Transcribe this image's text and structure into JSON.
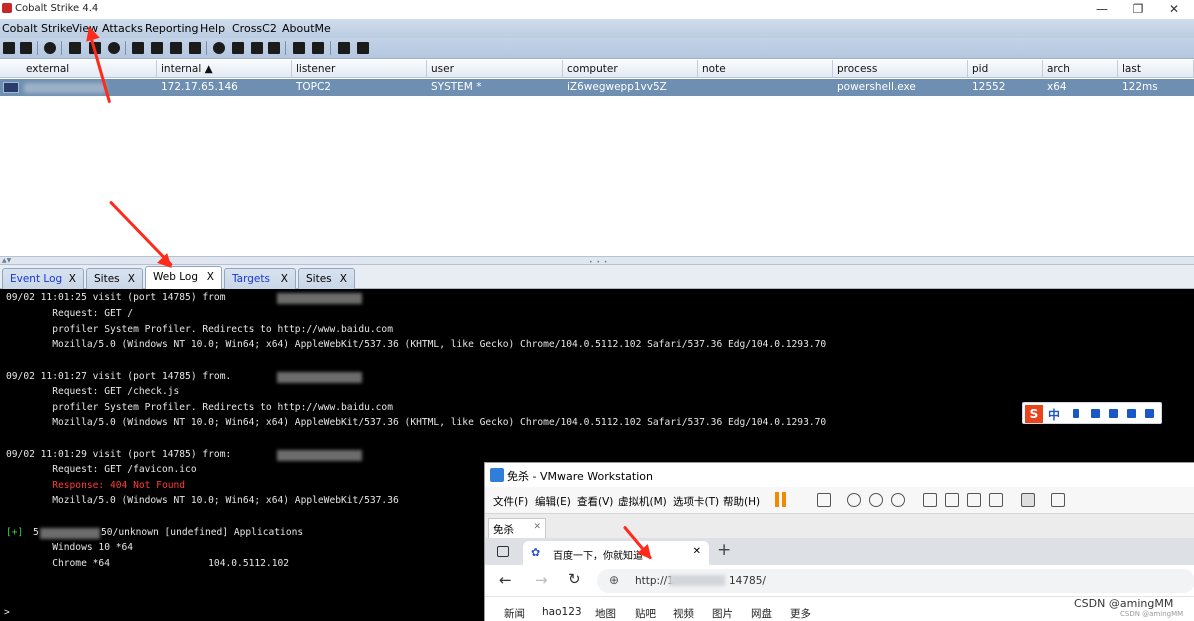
{
  "window": {
    "title": "Cobalt Strike 4.4"
  },
  "menu": [
    "Cobalt Strike",
    "View",
    "Attacks",
    "Reporting",
    "Help",
    "CrossC2",
    "AboutMe"
  ],
  "beacons": {
    "columns": [
      "external",
      "internal ▲",
      "listener",
      "user",
      "computer",
      "note",
      "process",
      "pid",
      "arch",
      "last"
    ],
    "row": {
      "external": "",
      "internal": "172.17.65.146",
      "listener": "TOPC2",
      "user": "SYSTEM *",
      "computer": "iZ6wegwepp1vv5Z",
      "note": "",
      "process": "powershell.exe",
      "pid": "12552",
      "arch": "x64",
      "last": "122ms"
    }
  },
  "tabs": [
    {
      "label": "Event Log",
      "close": "X"
    },
    {
      "label": "Sites",
      "close": "X"
    },
    {
      "label": "Web Log",
      "close": "X"
    },
    {
      "label": "Targets",
      "close": "X"
    },
    {
      "label": "Sites",
      "close": "X"
    }
  ],
  "console": {
    "lines": [
      "09/02 11:01:25 visit (port 14785) from",
      "        Request: GET /",
      "        profiler System Profiler. Redirects to http://www.baidu.com",
      "        Mozilla/5.0 (Windows NT 10.0; Win64; x64) AppleWebKit/537.36 (KHTML, like Gecko) Chrome/104.0.5112.102 Safari/537.36 Edg/104.0.1293.70",
      "09/02 11:01:27 visit (port 14785) from.",
      "        Request: GET /check.js",
      "        profiler System Profiler. Redirects to http://www.baidu.com",
      "        Mozilla/5.0 (Windows NT 10.0; Win64; x64) AppleWebKit/537.36 (KHTML, like Gecko) Chrome/104.0.5112.102 Safari/537.36 Edg/104.0.1293.70",
      "09/02 11:01:29 visit (port 14785) from:",
      "        Request: GET /favicon.ico",
      "        Response: ",
      "        Mozilla/5.0 (Windows NT 10.0; Win64; x64) AppleWebKit/537.36",
      "[+] ",
      "5",
      "50/unknown [undefined] Applications",
      "        Windows 10 *64",
      "        Chrome *64                 104.0.5112.102",
      ">"
    ],
    "error_text": "404 Not Found"
  },
  "ime": {
    "label": "中",
    "glyph": "S"
  },
  "vmware": {
    "title": "免杀 - VMware Workstation",
    "menu": [
      "文件(F)",
      "编辑(E)",
      "查看(V)",
      "虚拟机(M)",
      "选项卡(T)",
      "帮助(H)"
    ],
    "vm_tab": "免杀",
    "browser_tab": "百度一下，你就知道",
    "url_prefix": "http://1",
    "url_suffix": "14785/",
    "nav_links": [
      "新闻",
      "hao123",
      "地图",
      "贴吧",
      "视频",
      "图片",
      "网盘",
      "更多"
    ]
  },
  "watermark": "CSDN @amingMM",
  "watermark_small": "CSDN @amingMM"
}
